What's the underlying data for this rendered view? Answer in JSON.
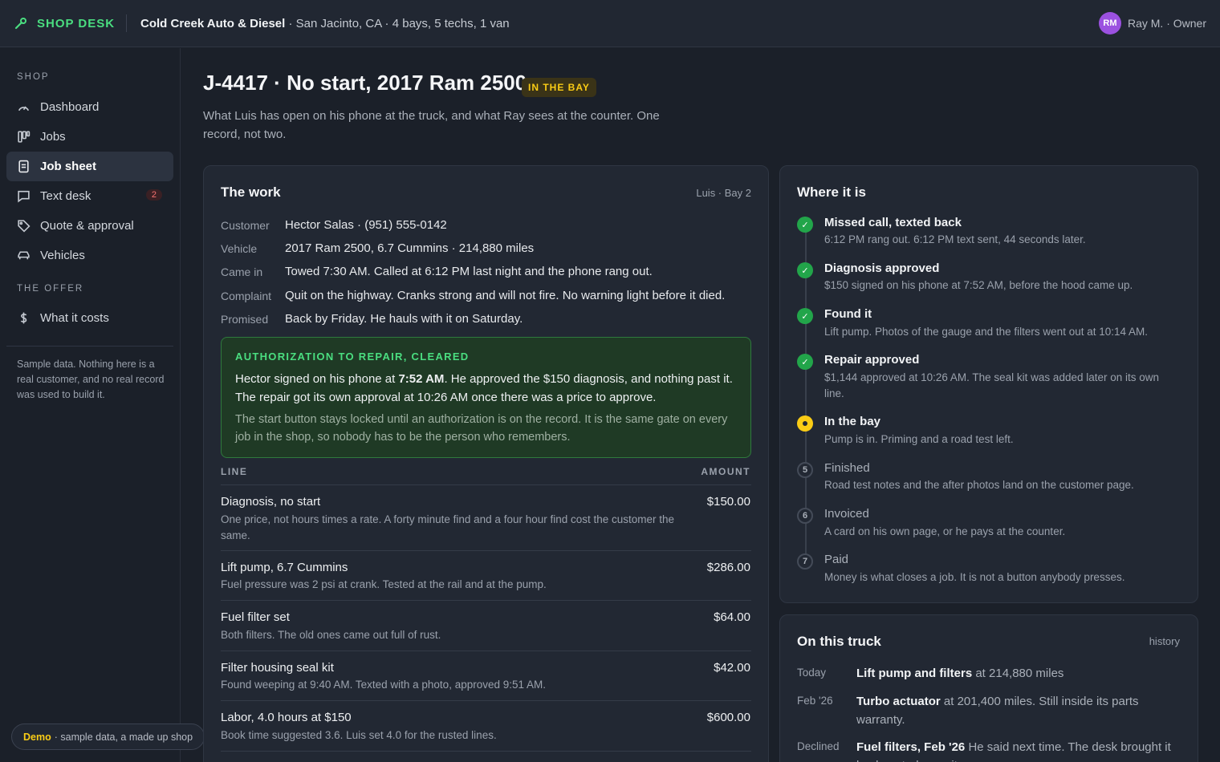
{
  "app": {
    "brand": "SHOP DESK",
    "shop_name": "Cold Creek Auto & Diesel",
    "shop_details": " · San Jacinto, CA · 4 bays, 5 techs, 1 van",
    "user_initials": "RM",
    "user_label": "Ray M. · Owner"
  },
  "sidebar": {
    "section_shop": "SHOP",
    "section_offer": "THE OFFER",
    "items": [
      {
        "label": "Dashboard",
        "icon": "gauge-icon"
      },
      {
        "label": "Jobs",
        "icon": "board-icon"
      },
      {
        "label": "Job sheet",
        "icon": "document-icon",
        "active": true
      },
      {
        "label": "Text desk",
        "icon": "chat-icon",
        "badge": "2"
      },
      {
        "label": "Quote & approval",
        "icon": "tag-icon"
      },
      {
        "label": "Vehicles",
        "icon": "car-icon"
      },
      {
        "label": "What it costs",
        "icon": "dollar-icon"
      }
    ],
    "note": "Sample data. Nothing here is a real customer, and no real record was used to build it.",
    "demo_label": "Demo",
    "demo_text": "· sample data, a made up shop"
  },
  "header": {
    "title": "J-4417 · No start, 2017 Ram 2500",
    "status": "IN THE BAY",
    "subtitle": "What Luis has open on his phone at the truck, and what Ray sees at the counter. One record, not two."
  },
  "work": {
    "title": "The work",
    "meta": "Luis · Bay 2",
    "fields": [
      {
        "label": "Customer",
        "value": "Hector Salas · (951) 555-0142"
      },
      {
        "label": "Vehicle",
        "value": "2017 Ram 2500, 6.7 Cummins · 214,880 miles"
      },
      {
        "label": "Came in",
        "value": "Towed 7:30 AM. Called at 6:12 PM last night and the phone rang out."
      },
      {
        "label": "Complaint",
        "value": "Quit on the highway. Cranks strong and will not fire. No warning light before it died."
      },
      {
        "label": "Promised",
        "value": "Back by Friday. He hauls with it on Saturday."
      }
    ],
    "auth": {
      "heading": "AUTHORIZATION TO REPAIR, CLEARED",
      "body_before": "Hector signed on his phone at ",
      "body_time": "7:52 AM",
      "body_after": ". He approved the $150 diagnosis, and nothing past it. The repair got its own approval at 10:26 AM once there was a price to approve.",
      "note": "The start button stays locked until an authorization is on the record. It is the same gate on every job in the shop, so nobody has to be the person who remembers."
    },
    "table_headers": {
      "line": "LINE",
      "amount": "AMOUNT"
    },
    "lines": [
      {
        "name": "Diagnosis, no start",
        "amount": "$150.00",
        "desc": "One price, not hours times a rate. A forty minute find and a four hour find cost the customer the same."
      },
      {
        "name": "Lift pump, 6.7 Cummins",
        "amount": "$286.00",
        "desc": "Fuel pressure was 2 psi at crank. Tested at the rail and at the pump."
      },
      {
        "name": "Fuel filter set",
        "amount": "$64.00",
        "desc": "Both filters. The old ones came out full of rust."
      },
      {
        "name": "Filter housing seal kit",
        "amount": "$42.00",
        "desc": "Found weeping at 9:40 AM. Texted with a photo, approved 9:51 AM."
      },
      {
        "name": "Labor, 4.0 hours at $150",
        "amount": "$600.00",
        "desc": "Book time suggested 3.6. Luis set 4.0 for the rusted lines."
      }
    ]
  },
  "timeline": {
    "title": "Where it is",
    "steps": [
      {
        "state": "done",
        "title": "Missed call, texted back",
        "desc": "6:12 PM rang out. 6:12 PM text sent, 44 seconds later."
      },
      {
        "state": "done",
        "title": "Diagnosis approved",
        "desc": "$150 signed on his phone at 7:52 AM, before the hood came up."
      },
      {
        "state": "done",
        "title": "Found it",
        "desc": "Lift pump. Photos of the gauge and the filters went out at 10:14 AM."
      },
      {
        "state": "done",
        "title": "Repair approved",
        "desc": "$1,144 approved at 10:26 AM. The seal kit was added later on its own line."
      },
      {
        "state": "current",
        "title": "In the bay",
        "desc": "Pump is in. Priming and a road test left."
      },
      {
        "state": "pending",
        "num": "5",
        "title": "Finished",
        "desc": "Road test notes and the after photos land on the customer page."
      },
      {
        "state": "pending",
        "num": "6",
        "title": "Invoiced",
        "desc": "A card on his own page, or he pays at the counter."
      },
      {
        "state": "pending",
        "num": "7",
        "title": "Paid",
        "desc": "Money is what closes a job. It is not a button anybody presses."
      }
    ]
  },
  "history": {
    "title": "On this truck",
    "link": "history",
    "entries": [
      {
        "when": "Today",
        "bold": "Lift pump and filters",
        "rest": " at 214,880 miles"
      },
      {
        "when": "Feb '26",
        "bold": "Turbo actuator",
        "rest": " at 201,400 miles. Still inside its parts warranty."
      },
      {
        "when": "Declined",
        "bold": "Fuel filters, Feb '26",
        "rest": " He said next time. The desk brought it back up today on its own."
      }
    ]
  },
  "colors": {
    "accent_green": "#4ade80",
    "status_yellow": "#facc15",
    "done_green": "#22a54a",
    "avatar_purple": "#9b51e0",
    "badge_red": "#f87171"
  }
}
